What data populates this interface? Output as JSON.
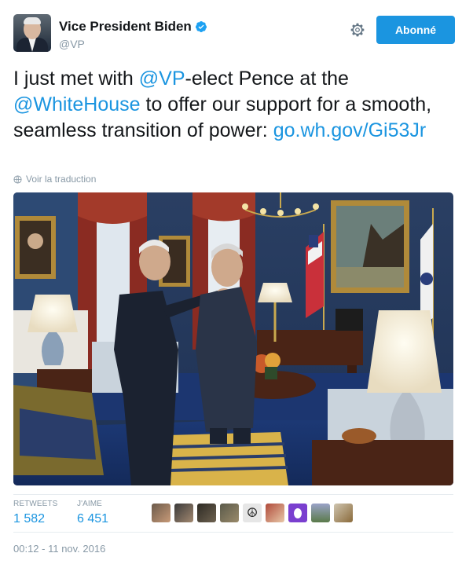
{
  "author": {
    "display_name": "Vice President Biden",
    "handle": "@VP",
    "follow_button_label": "Abonné"
  },
  "tweet": {
    "text_segments": [
      {
        "text": "I just met with ",
        "type": "plain"
      },
      {
        "text": "@VP",
        "type": "mention"
      },
      {
        "text": "-elect Pence at the ",
        "type": "plain"
      },
      {
        "text": "@WhiteHouse",
        "type": "mention"
      },
      {
        "text": " to offer our support for a smooth, seamless transition of power: ",
        "type": "plain"
      },
      {
        "text": "go.wh.gov/Gi53Jr",
        "type": "link"
      }
    ],
    "translate_label": "Voir la traduction"
  },
  "stats": {
    "retweets_label": "RETWEETS",
    "retweets_value": "1 582",
    "likes_label": "J'AIME",
    "likes_value": "6 451"
  },
  "likers": [
    "liker-1",
    "liker-2",
    "liker-3",
    "liker-4",
    "liker-5",
    "liker-6",
    "liker-7",
    "liker-8",
    "liker-9"
  ],
  "timestamp": "00:12 - 11 nov. 2016",
  "colors": {
    "accent": "#1b95e0",
    "muted": "#8899a6",
    "text": "#14171a"
  },
  "icons": {
    "verified": "verified-badge-icon",
    "settings": "gear-icon",
    "translate": "globe-icon"
  }
}
